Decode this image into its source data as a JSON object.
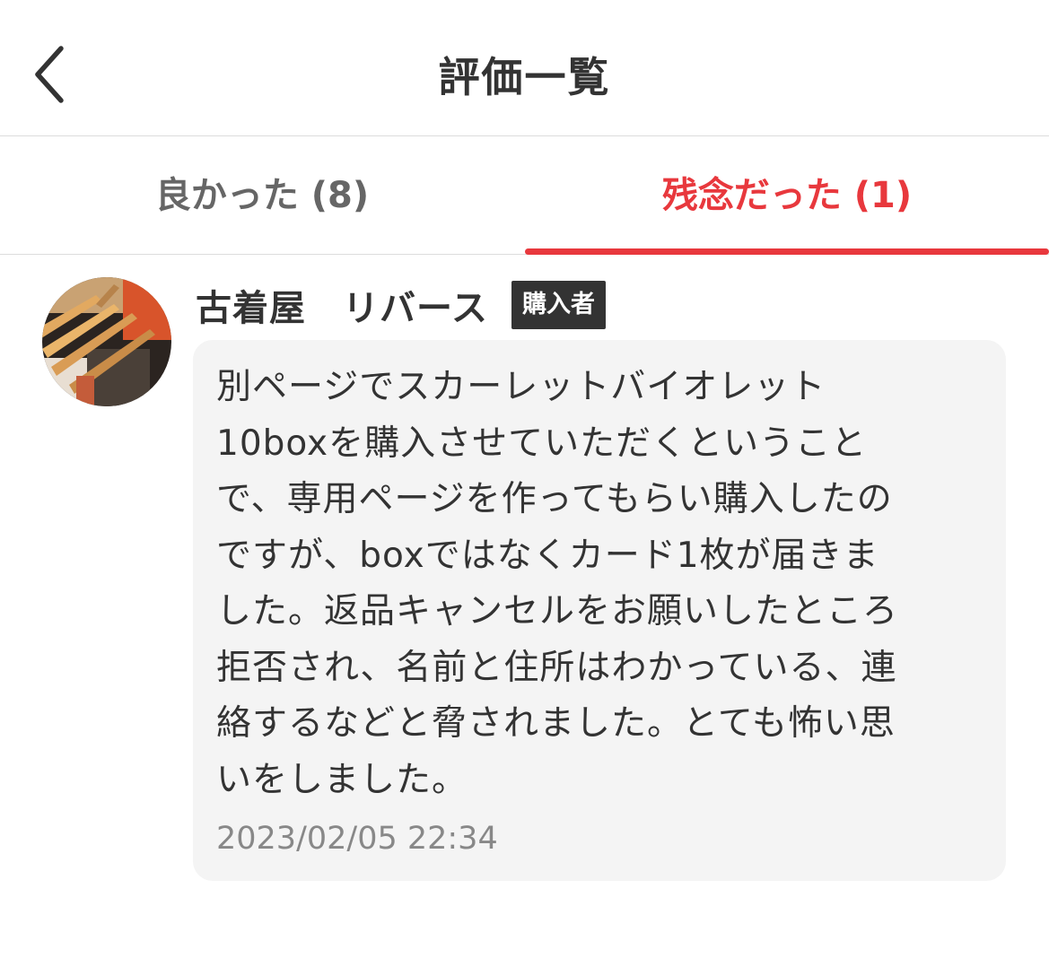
{
  "header": {
    "title": "評価一覧",
    "back_icon": "chevron-left-icon"
  },
  "tabs": [
    {
      "label": "良かった (8)",
      "active": false
    },
    {
      "label": "残念だった (1)",
      "active": true
    }
  ],
  "colors": {
    "accent": "#e8383d",
    "text": "#333333",
    "muted": "#888888",
    "bubble_bg": "#f4f4f4",
    "badge_bg": "#333333"
  },
  "review": {
    "reviewer_name": "古着屋　リバース",
    "role_badge": "購入者",
    "comment_lines": [
      "別ページでスカーレットバイオレット",
      "10boxを購入させていただくということ",
      "で、専用ページを作ってもらい購入したの",
      "ですが、boxではなくカード1枚が届きま",
      "した。返品キャンセルをお願いしたところ",
      "拒否され、名前と住所はわかっている、連",
      "絡するなどと脅されました。とても怖い思",
      "いをしました。"
    ],
    "timestamp": "2023/02/05 22:34"
  }
}
